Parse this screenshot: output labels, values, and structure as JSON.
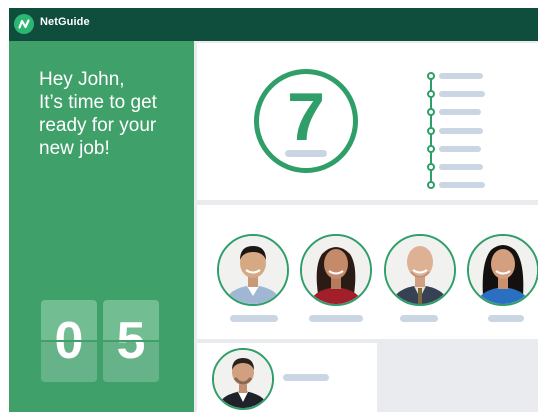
{
  "app": {
    "name": "NetGuide",
    "logo_icon": "netguide-logo-icon",
    "accent": "#2f9e68",
    "header_color": "#0f4d3c",
    "sidebar_color": "#3fa06a"
  },
  "sidebar": {
    "greeting_lines": [
      "Hey John,",
      "It’s time to get",
      "ready for your",
      "new job!"
    ],
    "countdown_digits": [
      "0",
      "5"
    ]
  },
  "timeline_card": {
    "number": "7",
    "step_count": 7
  },
  "team_card": {
    "members": [
      {
        "icon": "man-portrait-avatar"
      },
      {
        "icon": "woman-portrait-avatar"
      },
      {
        "icon": "bald-man-portrait-avatar"
      },
      {
        "icon": "woman-dark-hair-portrait-avatar"
      }
    ]
  },
  "person_card": {
    "icon": "man-suit-portrait-avatar"
  }
}
